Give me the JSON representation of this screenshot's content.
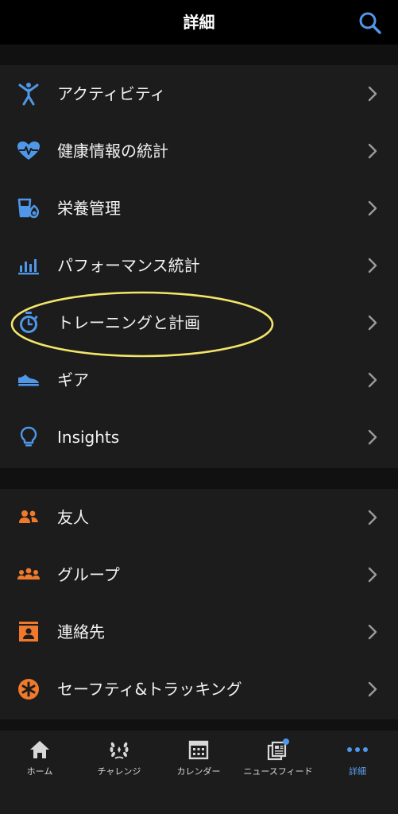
{
  "header": {
    "title": "詳細",
    "search_icon": "search-icon"
  },
  "colors": {
    "blue_accent": "#4f97e8",
    "orange_accent": "#f07a2c",
    "highlight": "#f3e56a",
    "background": "#1c1c1c",
    "header_background": "#000000"
  },
  "menu_section_1": [
    {
      "label": "アクティビティ",
      "icon": "activity-figure-icon"
    },
    {
      "label": "健康情報の統計",
      "icon": "heart-pulse-icon"
    },
    {
      "label": "栄養管理",
      "icon": "nutrition-icon"
    },
    {
      "label": "パフォーマンス統計",
      "icon": "bar-chart-icon"
    },
    {
      "label": "トレーニングと計画",
      "icon": "stopwatch-icon"
    },
    {
      "label": "ギア",
      "icon": "shoe-icon"
    },
    {
      "label": "Insights",
      "icon": "lightbulb-icon"
    }
  ],
  "menu_section_2": [
    {
      "label": "友人",
      "icon": "friends-icon"
    },
    {
      "label": "グループ",
      "icon": "group-icon"
    },
    {
      "label": "連絡先",
      "icon": "contact-card-icon"
    },
    {
      "label": "セーフティ&トラッキング",
      "icon": "safety-asterisk-icon"
    }
  ],
  "tabs": [
    {
      "label": "ホーム",
      "icon": "home-icon",
      "active": false
    },
    {
      "label": "チャレンジ",
      "icon": "laurel-icon",
      "active": false
    },
    {
      "label": "カレンダー",
      "icon": "calendar-icon",
      "active": false
    },
    {
      "label": "ニュースフィード",
      "icon": "newsfeed-icon",
      "active": false
    },
    {
      "label": "詳細",
      "icon": "more-dots-icon",
      "active": true
    }
  ]
}
